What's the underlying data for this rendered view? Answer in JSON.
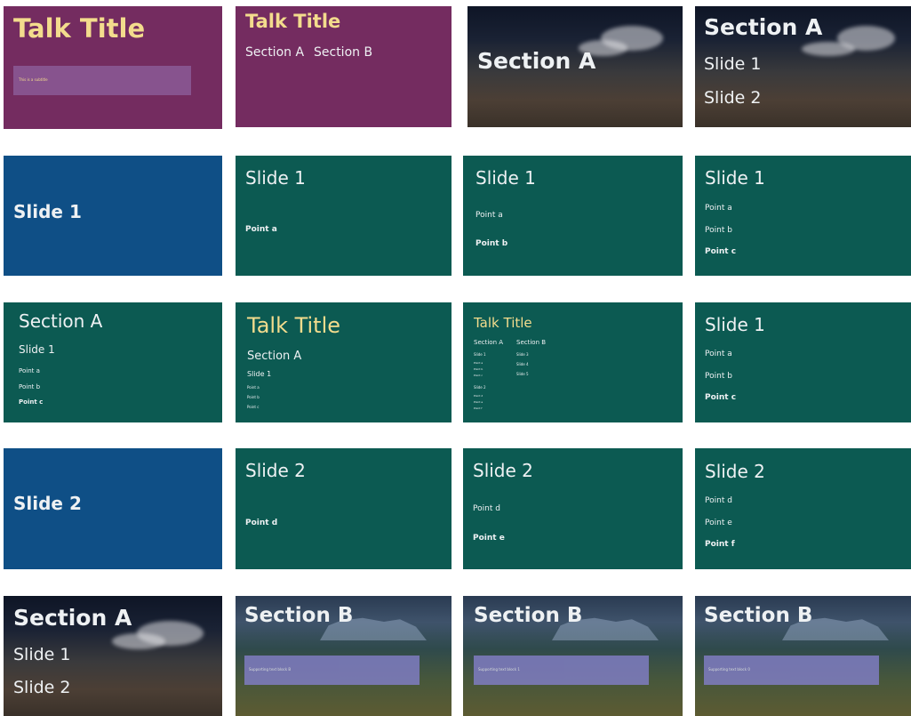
{
  "row1": {
    "s1": {
      "title": "Talk Title",
      "subtitle": "This is a subtitle"
    },
    "s2": {
      "title": "Talk Title",
      "sectionA": "Section A",
      "sectionB": "Section B"
    },
    "s3": {
      "title": "Section A"
    },
    "s4": {
      "title": "Section A",
      "item1": "Slide 1",
      "item2": "Slide 2"
    }
  },
  "row2": {
    "s1": {
      "title": "Slide 1"
    },
    "s2": {
      "title": "Slide 1",
      "p1": "Point a"
    },
    "s3": {
      "title": "Slide 1",
      "p1": "Point a",
      "p2": "Point b"
    },
    "s4": {
      "title": "Slide 1",
      "p1": "Point a",
      "p2": "Point b",
      "p3": "Point c"
    }
  },
  "row3": {
    "s1": {
      "title": "Section A",
      "sub": "Slide 1",
      "p1": "Point a",
      "p2": "Point b",
      "p3": "Point c"
    },
    "s2": {
      "title": "Talk Title",
      "sec": "Section A",
      "sub": "Slide 1",
      "p1": "Point a",
      "p2": "Point b",
      "p3": "Point c"
    },
    "s3": {
      "title": "Talk Title",
      "secA": "Section A",
      "secB": "Section B",
      "colA1": "Slide 1",
      "colA1p1": "Point a",
      "colA1p2": "Point b",
      "colA1p3": "Point c",
      "colA2": "Slide 2",
      "colA2p1": "Point d",
      "colA2p2": "Point e",
      "colA2p3": "Point f",
      "colB1": "Slide 3",
      "colB2": "Slide 4",
      "colB3": "Slide 5"
    },
    "s4": {
      "title": "Slide 1",
      "p1": "Point a",
      "p2": "Point b",
      "p3": "Point c"
    }
  },
  "row4": {
    "s1": {
      "title": "Slide 2"
    },
    "s2": {
      "title": "Slide 2",
      "p1": "Point d"
    },
    "s3": {
      "title": "Slide 2",
      "p1": "Point d",
      "p2": "Point e"
    },
    "s4": {
      "title": "Slide 2",
      "p1": "Point d",
      "p2": "Point e",
      "p3": "Point f"
    }
  },
  "row5": {
    "s1": {
      "title": "Section A",
      "item1": "Slide 1",
      "item2": "Slide 2"
    },
    "s2": {
      "title": "Section B",
      "box": "Supporting text block B"
    },
    "s3": {
      "title": "Section B",
      "box": "Supporting text block 1"
    },
    "s4": {
      "title": "Section B",
      "box": "Supporting text block 0"
    }
  },
  "colors": {
    "purple": "#742c60",
    "blue": "#0f4f86",
    "green": "#0c5a52",
    "title_yellow": "#f3dc8d"
  }
}
